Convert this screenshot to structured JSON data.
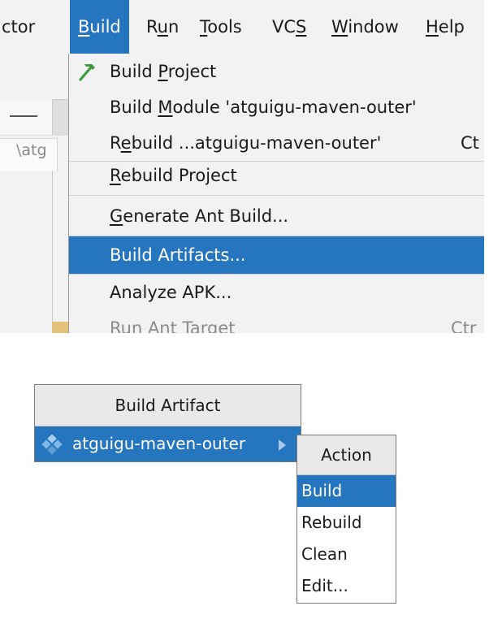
{
  "menubar": {
    "items": [
      {
        "label": "ctor",
        "mnemonic": null
      },
      {
        "pre": "",
        "u": "B",
        "post": "uild",
        "active": true
      },
      {
        "pre": "R",
        "u": "u",
        "post": "n"
      },
      {
        "pre": "",
        "u": "T",
        "post": "ools"
      },
      {
        "pre": "VC",
        "u": "S",
        "post": ""
      },
      {
        "pre": "",
        "u": "W",
        "post": "indow"
      },
      {
        "pre": "",
        "u": "H",
        "post": "elp"
      }
    ]
  },
  "editor": {
    "path_fragment": "\\atg"
  },
  "build_menu": {
    "items": [
      {
        "pre": "Build ",
        "u": "P",
        "post": "roject",
        "icon": "hammer-icon"
      },
      {
        "pre": "Build ",
        "u": "M",
        "post": "odule 'atguigu-maven-outer'"
      },
      {
        "pre": "R",
        "u": "e",
        "post": "build ...atguigu-maven-outer'",
        "shortcut": "Ct"
      },
      {
        "pre": "",
        "u": "R",
        "post": "ebuild Project"
      },
      {
        "pre": "",
        "u": "G",
        "post": "enerate Ant Build..."
      },
      {
        "pre": "Build Artifacts...",
        "u": "",
        "post": "",
        "selected": true
      },
      {
        "pre": "Analyze APK...",
        "u": "",
        "post": ""
      },
      {
        "pre": "Run Ant Target",
        "u": "",
        "post": "",
        "shortcut": "Ctr",
        "disabled": true
      }
    ]
  },
  "build_artifact_popup": {
    "header": "Build Artifact",
    "artifact": "atguigu-maven-outer",
    "icon": "artifact-diamond-icon"
  },
  "action_popup": {
    "header": "Action",
    "items": [
      "Build",
      "Rebuild",
      "Clean",
      "Edit..."
    ],
    "selected_index": 0
  },
  "colors": {
    "selection": "#2675bf",
    "menu_bg": "#f2f2f2",
    "hammer": "#3d9a3d",
    "artifact_icon": "#7fb7e6"
  }
}
